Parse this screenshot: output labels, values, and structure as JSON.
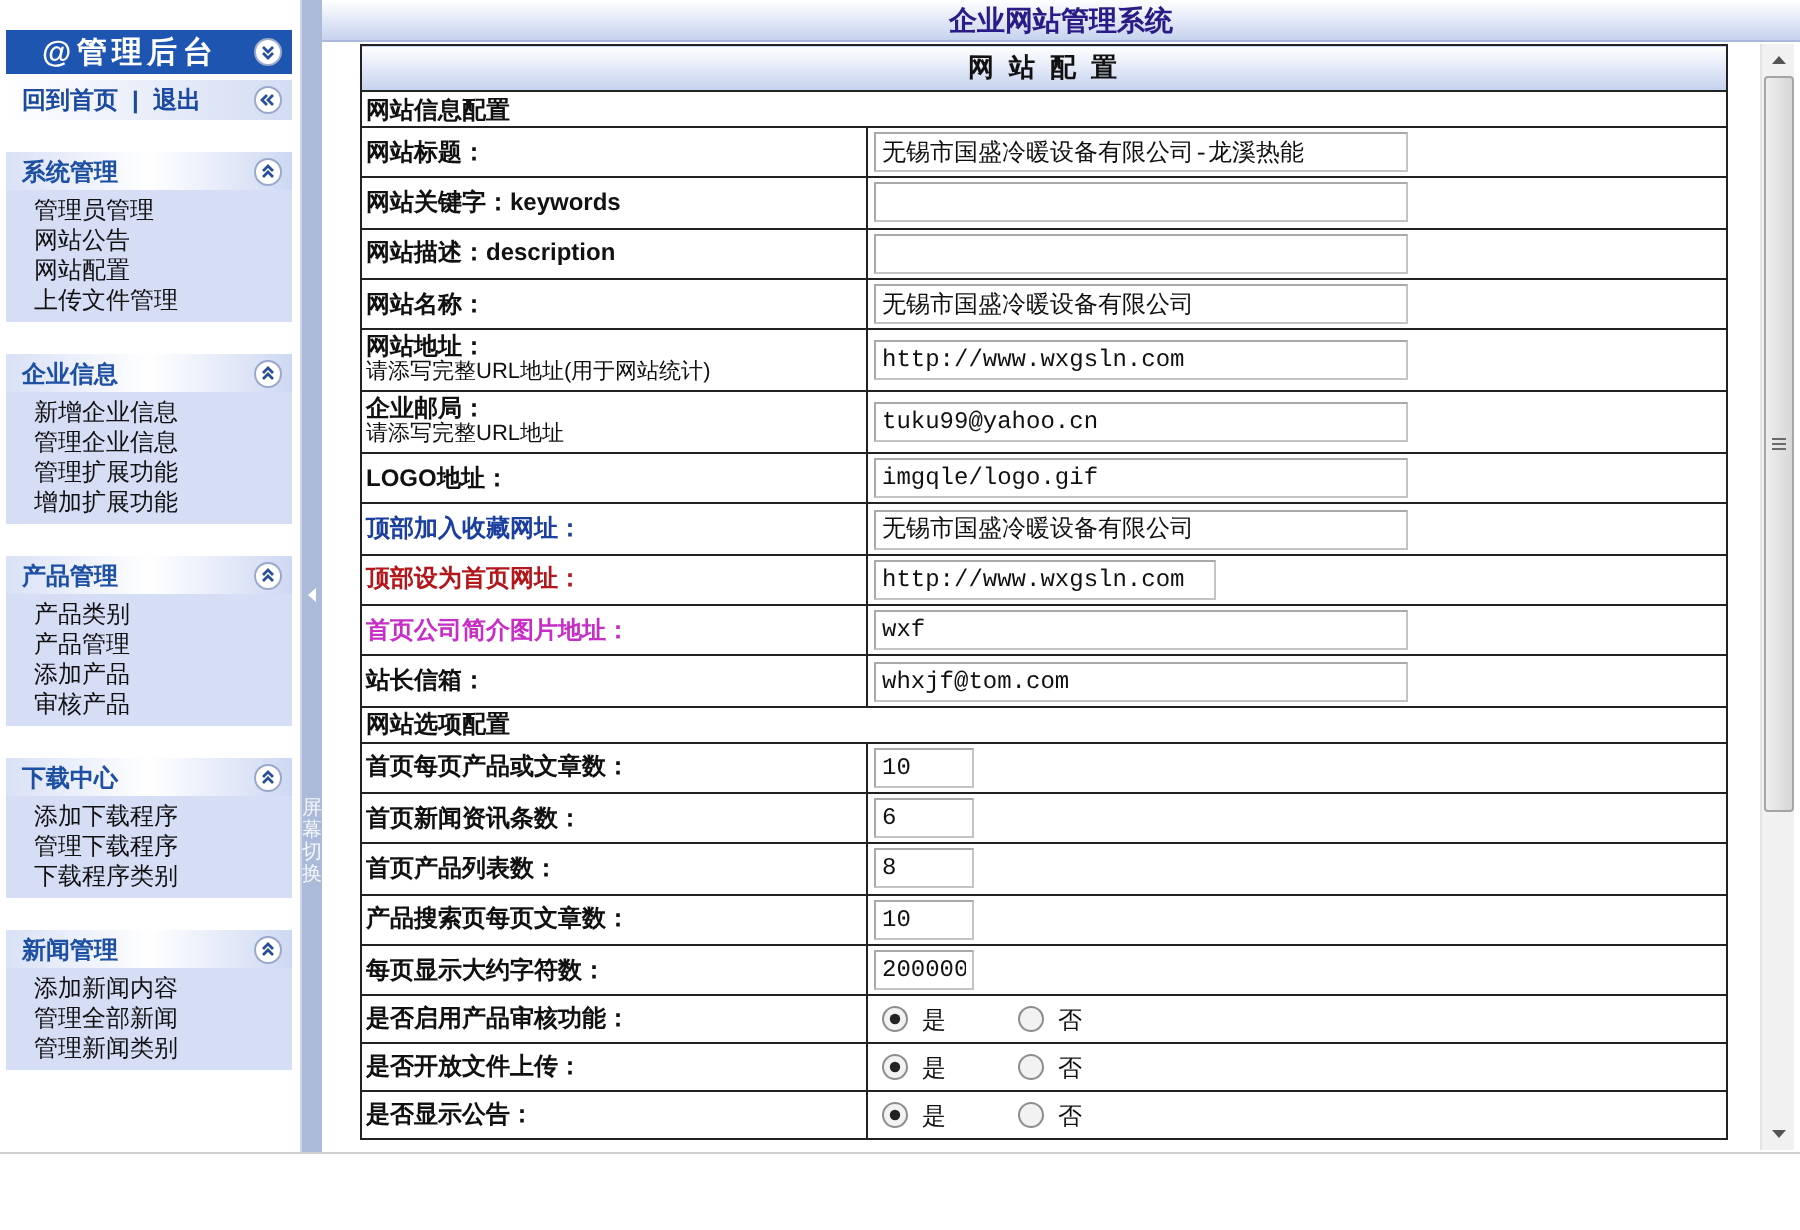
{
  "sidebar": {
    "title": "@管理后台",
    "links": [
      {
        "label": "回到首页"
      },
      {
        "label": "退出"
      }
    ],
    "link_separator": "|",
    "sections": [
      {
        "title": "系统管理",
        "expanded": true,
        "items": [
          "管理员管理",
          "网站公告",
          "网站配置",
          "上传文件管理"
        ]
      },
      {
        "title": "企业信息",
        "expanded": true,
        "items": [
          "新增企业信息",
          "管理企业信息",
          "管理扩展功能",
          "增加扩展功能"
        ]
      },
      {
        "title": "产品管理",
        "expanded": true,
        "items": [
          "产品类别",
          "产品管理",
          "添加产品",
          "审核产品"
        ]
      },
      {
        "title": "下载中心",
        "expanded": true,
        "items": [
          "添加下载程序",
          "管理下载程序",
          "下载程序类别"
        ]
      },
      {
        "title": "新闻管理",
        "expanded": true,
        "items": [
          "添加新闻内容",
          "管理全部新闻",
          "管理新闻类别"
        ]
      }
    ]
  },
  "splitter": {
    "label": "屏幕切换"
  },
  "header": {
    "title": "企业网站管理系统"
  },
  "form": {
    "title": "网 站 配 置",
    "groups": [
      {
        "title": "网站信息配置",
        "rows": [
          {
            "kind": "wide",
            "label": "网站标题：",
            "value": "无锡市国盛冷暖设备有限公司-龙溪热能"
          },
          {
            "kind": "wide",
            "label": "网站关键字：keywords"
          },
          {
            "kind": "wide",
            "label": "网站描述：description"
          },
          {
            "kind": "wide",
            "label": "网站名称：",
            "value": "无锡市国盛冷暖设备有限公司"
          },
          {
            "kind": "wide",
            "label": "网站地址：",
            "note": "请添写完整URL地址(用于网站统计)",
            "value": "http://www.wxgsln.com"
          },
          {
            "kind": "wide",
            "label": "企业邮局：",
            "note": "请添写完整URL地址",
            "value": "tuku99@yahoo.cn"
          },
          {
            "kind": "wide",
            "label": "LOGO地址：",
            "value": "imgqle/logo.gif"
          },
          {
            "kind": "wide",
            "label": "顶部加入收藏网址：",
            "color": "#1b3f9e",
            "value": "无锡市国盛冷暖设备有限公司"
          },
          {
            "kind": "medium",
            "label": "顶部设为首页网址：",
            "color": "#b3171c",
            "value": "http://www.wxgsln.com"
          },
          {
            "kind": "wide",
            "label": "首页公司简介图片地址：",
            "color": "#c62ec6",
            "value": "wxf"
          },
          {
            "kind": "wide",
            "label": "站长信箱：",
            "value": "whxjf@tom.com"
          }
        ]
      },
      {
        "title": "网站选项配置",
        "rows": [
          {
            "kind": "short",
            "label": "首页每页产品或文章数：",
            "value": "10"
          },
          {
            "kind": "short",
            "label": "首页新闻资讯条数：",
            "value": "6"
          },
          {
            "kind": "short",
            "label": "首页产品列表数：",
            "value": "8"
          },
          {
            "kind": "short",
            "label": "产品搜索页每页文章数：",
            "value": "10"
          },
          {
            "kind": "short",
            "label": "每页显示大约字符数：",
            "value": "200000"
          },
          {
            "kind": "radio",
            "label": "是否启用产品审核功能：",
            "options": [
              {
                "label": "是",
                "selected": true
              },
              {
                "label": "否",
                "selected": false
              }
            ]
          },
          {
            "kind": "radio",
            "label": "是否开放文件上传：",
            "options": [
              {
                "label": "是",
                "selected": true
              },
              {
                "label": "否",
                "selected": false
              }
            ]
          },
          {
            "kind": "radio",
            "label": "是否显示公告：",
            "options": [
              {
                "label": "是",
                "selected": true
              },
              {
                "label": "否",
                "selected": false
              }
            ]
          }
        ]
      }
    ]
  }
}
